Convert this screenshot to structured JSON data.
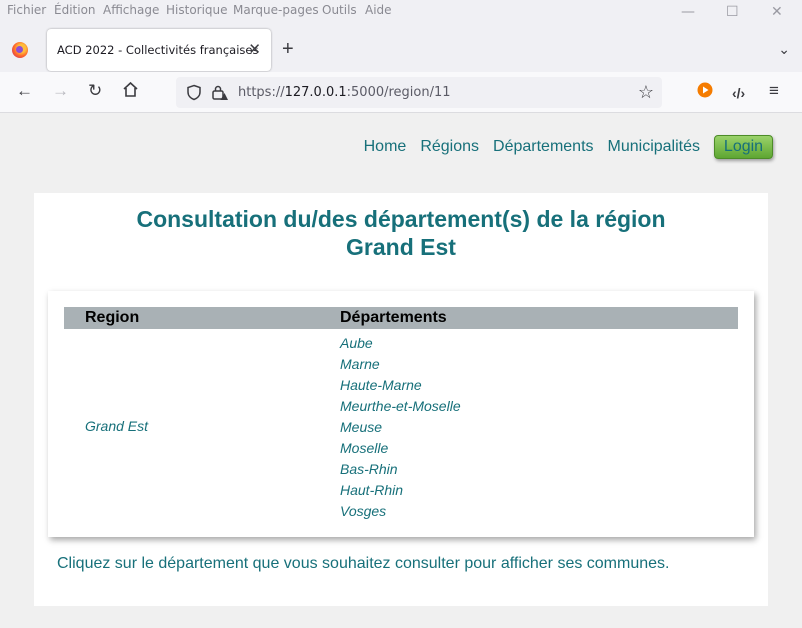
{
  "menu": [
    "Fichier",
    "Édition",
    "Affichage",
    "Historique",
    "Marque-pages",
    "Outils",
    "Aide"
  ],
  "tab": {
    "title": "ACD 2022 - Collectivités françaises"
  },
  "address": {
    "scheme": "https://",
    "host": "127.0.0.1",
    "rest": ":5000/region/11"
  },
  "nav": {
    "home": "Home",
    "regions": "Régions",
    "departements": "Départements",
    "municipalites": "Municipalités",
    "login": "Login"
  },
  "page": {
    "title_line1": "Consultation du/des département(s) de la région",
    "title_line2": "Grand Est",
    "table": {
      "headers": [
        "Region",
        "Départements"
      ],
      "region": "Grand Est",
      "departements": [
        "Aube",
        "Marne",
        "Haute-Marne",
        "Meurthe-et-Moselle",
        "Meuse",
        "Moselle",
        "Bas-Rhin",
        "Haut-Rhin",
        "Vosges"
      ]
    },
    "hint": "Cliquez sur le département que vous souhaitez consulter pour afficher ses communes."
  },
  "colors": {
    "accent": "#17707a",
    "header_bg": "#a9b1b5",
    "login_green": "#7cbd4a"
  }
}
